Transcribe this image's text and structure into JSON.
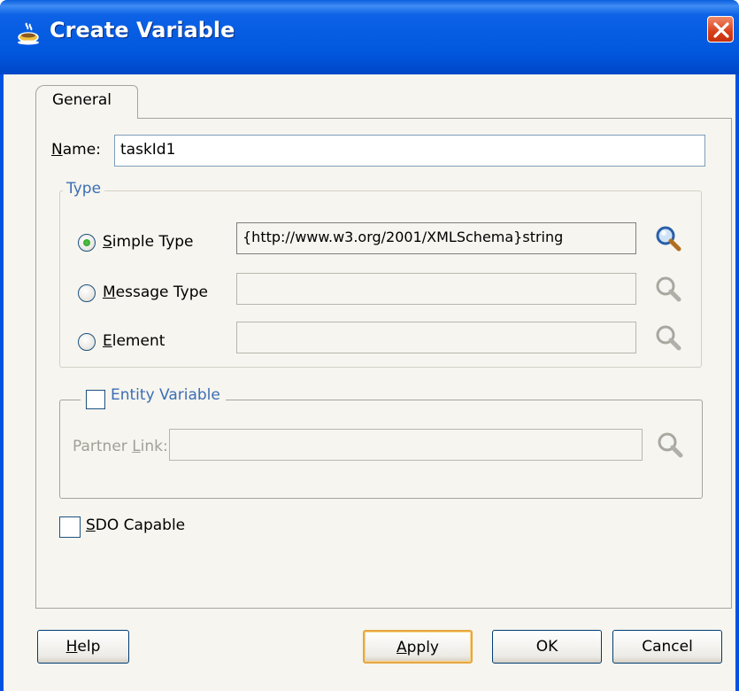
{
  "window": {
    "title": "Create Variable"
  },
  "tabs": [
    {
      "label": "General"
    }
  ],
  "name": {
    "label_first": "N",
    "label_rest": "ame:",
    "value": "taskId1"
  },
  "type_group": {
    "title": "Type",
    "options": [
      {
        "label_first": "S",
        "label_rest": "imple Type",
        "value": "{http://www.w3.org/2001/XMLSchema}string",
        "selected": true,
        "enabled": true
      },
      {
        "label_first": "M",
        "label_rest": "essage Type",
        "value": "",
        "selected": false,
        "enabled": false
      },
      {
        "label_first": "E",
        "label_rest": "lement",
        "value": "",
        "selected": false,
        "enabled": false
      }
    ]
  },
  "entity_group": {
    "title": "Entity Variable",
    "checked": false,
    "partner_link": {
      "label_before": "Partner ",
      "label_u": "L",
      "label_after": "ink:",
      "value": ""
    }
  },
  "sdo": {
    "label_first": "S",
    "label_rest": "DO Capable",
    "checked": false
  },
  "buttons": {
    "help": {
      "first": "H",
      "rest": "elp"
    },
    "apply": {
      "first": "A",
      "rest": "pply"
    },
    "ok": "OK",
    "cancel": "Cancel"
  },
  "colors": {
    "title_bar": "#0158de",
    "close": "#d8401c",
    "group_title": "#3c6eb4",
    "default_button_border": "#e8a642"
  },
  "icons": {
    "title": "coffee-cup-icon",
    "close": "close-icon",
    "browse": "magnifier-icon"
  }
}
